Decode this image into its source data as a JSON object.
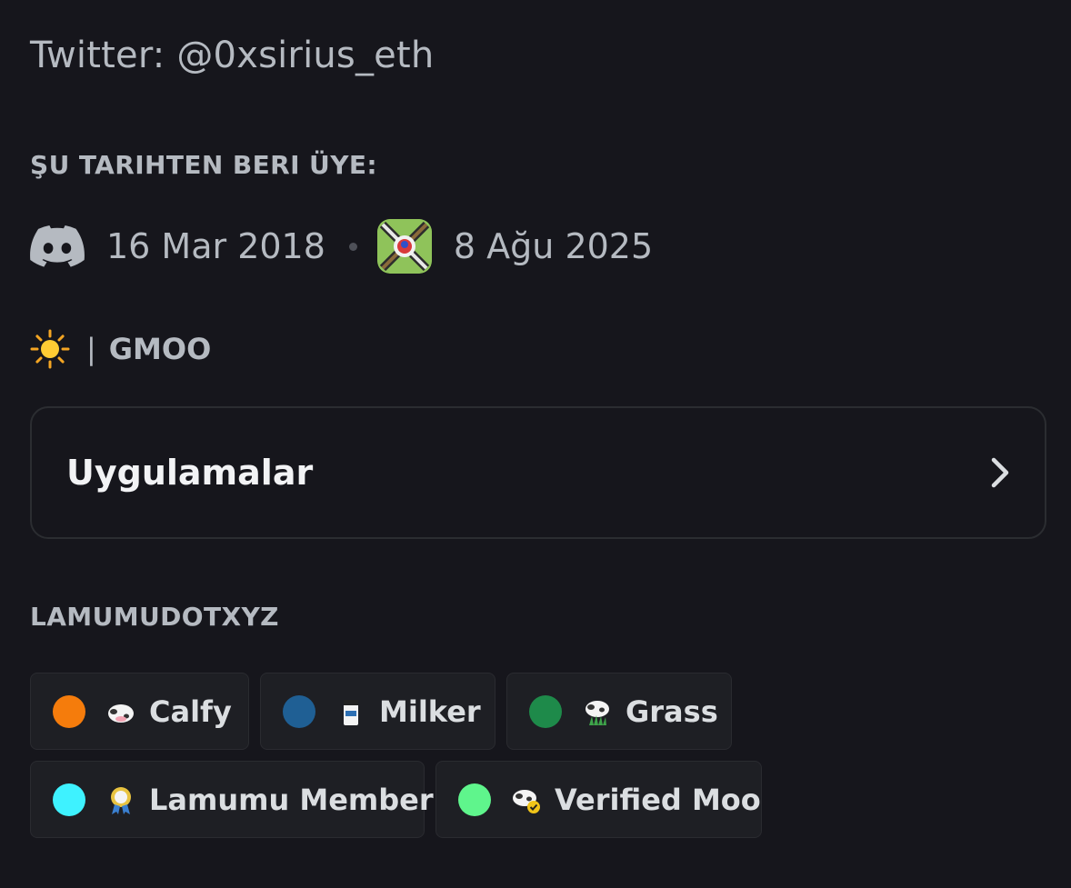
{
  "bio": {
    "text": "Twitter: @0xsirius_eth"
  },
  "member_since": {
    "title": "ŞU TARIHTEN BERI ÜYE:",
    "discord_date": "16 Mar 2018",
    "server_date": "8 Ağu 2025"
  },
  "status": {
    "emoji": "sun-icon",
    "separator": "|",
    "text": "GMOO"
  },
  "apps": {
    "label": "Uygulamalar"
  },
  "roles": {
    "title": "LAMUMUDOTXYZ",
    "items": [
      {
        "name": "Calfy",
        "color": "#f57c0c",
        "emoji": "calf-icon"
      },
      {
        "name": "Milker",
        "color": "#1f5f94",
        "emoji": "milk-carton-icon"
      },
      {
        "name": "Grass",
        "color": "#1e8a4a",
        "emoji": "cow-grass-icon"
      },
      {
        "name": "Lamumu Member",
        "color": "#3ef2ff",
        "emoji": "member-badge-icon"
      },
      {
        "name": "Verified Moo",
        "color": "#5ff58c",
        "emoji": "verified-cow-icon"
      }
    ]
  }
}
